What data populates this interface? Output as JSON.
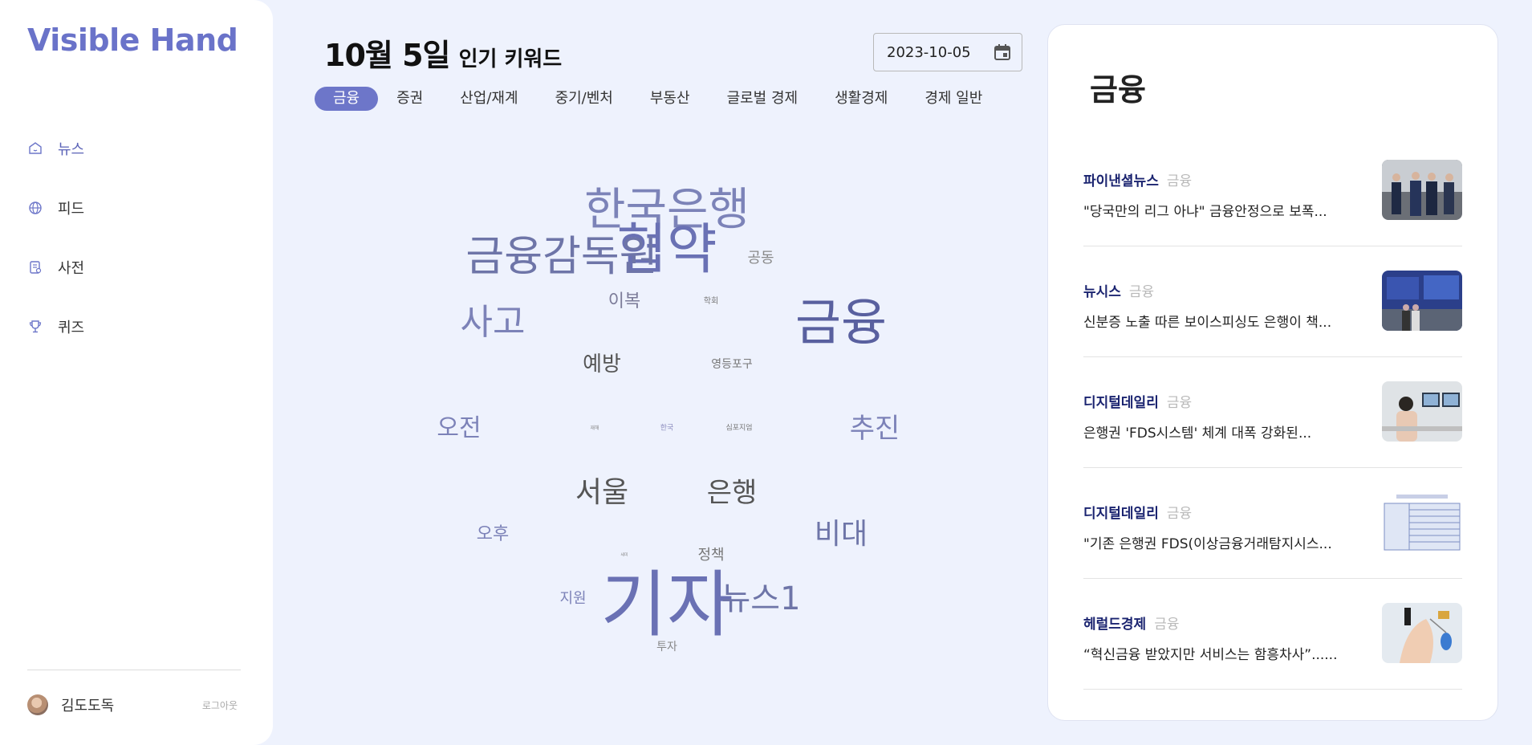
{
  "app": {
    "logo": "Visible Hand"
  },
  "sidebar": {
    "items": [
      {
        "label": "뉴스",
        "icon": "home-icon",
        "active": true
      },
      {
        "label": "피드",
        "icon": "globe-icon",
        "active": false
      },
      {
        "label": "사전",
        "icon": "dictionary-icon",
        "active": false
      },
      {
        "label": "퀴즈",
        "icon": "trophy-icon",
        "active": false
      }
    ],
    "user": {
      "name": "김도도독",
      "logout": "로그아웃"
    }
  },
  "header": {
    "date_big": "10월 5일",
    "subtitle": "인기 키워드",
    "date_value": "2023-10-05"
  },
  "tabs": [
    {
      "label": "금융",
      "active": true
    },
    {
      "label": "증권"
    },
    {
      "label": "산업/재계"
    },
    {
      "label": "중기/벤처"
    },
    {
      "label": "부동산"
    },
    {
      "label": "글로벌 경제"
    },
    {
      "label": "생활경제"
    },
    {
      "label": "경제 일반"
    }
  ],
  "wordcloud": [
    {
      "text": "한국은행",
      "weight": 56,
      "color": "#7c83b8"
    },
    {
      "text": "협약",
      "weight": 68,
      "color": "#6a71b4"
    },
    {
      "text": "금융감독원",
      "weight": 52,
      "color": "#6e75a8"
    },
    {
      "text": "공동",
      "weight": 18,
      "color": "#888"
    },
    {
      "text": "이복",
      "weight": 22,
      "color": "#7c7c99"
    },
    {
      "text": "학회",
      "weight": 10,
      "color": "#777"
    },
    {
      "text": "사고",
      "weight": 44,
      "color": "#7c82b8"
    },
    {
      "text": "금융",
      "weight": 62,
      "color": "#59609f"
    },
    {
      "text": "예방",
      "weight": 26,
      "color": "#555"
    },
    {
      "text": "영등포구",
      "weight": 14,
      "color": "#777"
    },
    {
      "text": "오전",
      "weight": 30,
      "color": "#7c82b8"
    },
    {
      "text": "재해",
      "weight": 6,
      "color": "#888"
    },
    {
      "text": "한국",
      "weight": 9,
      "color": "#8e8ec0"
    },
    {
      "text": "심포지엄",
      "weight": 9,
      "color": "#777"
    },
    {
      "text": "추진",
      "weight": 34,
      "color": "#7c82b8"
    },
    {
      "text": "서울",
      "weight": 36,
      "color": "#555"
    },
    {
      "text": "은행",
      "weight": 34,
      "color": "#555"
    },
    {
      "text": "오후",
      "weight": 22,
      "color": "#7c82b8"
    },
    {
      "text": "비대",
      "weight": 36,
      "color": "#6e75a8"
    },
    {
      "text": "정책",
      "weight": 18,
      "color": "#777"
    },
    {
      "text": "세미",
      "weight": 5,
      "color": "#888"
    },
    {
      "text": "지원",
      "weight": 18,
      "color": "#7c82b8"
    },
    {
      "text": "기자",
      "weight": 90,
      "color": "#6a71b4"
    },
    {
      "text": "뉴스1",
      "weight": 40,
      "color": "#6e75a8"
    },
    {
      "text": "투자",
      "weight": 14,
      "color": "#888"
    }
  ],
  "panel": {
    "title": "금융",
    "news": [
      {
        "source": "파이낸셜뉴스",
        "category": "금융",
        "headline": "\"당국만의 리그 아냐\" 금융안정으로 보폭...",
        "thumb": "people-photo"
      },
      {
        "source": "뉴시스",
        "category": "금융",
        "headline": "신분증 노출 따른 보이스피싱도 은행이 책...",
        "thumb": "conference-photo"
      },
      {
        "source": "디지털데일리",
        "category": "금융",
        "headline": "은행권 'FDS시스템' 체계 대폭 강화된...",
        "thumb": "office-photo"
      },
      {
        "source": "디지털데일리",
        "category": "금융",
        "headline": "\"기존 은행권 FDS(이상금융거래탐지시스...",
        "thumb": "document-photo"
      },
      {
        "source": "헤럴드경제",
        "category": "금융",
        "headline": "“혁신금융 받았지만 서비스는 함흥차사”......",
        "thumb": "product-photo"
      }
    ]
  },
  "colors": {
    "accent": "#6d76c9",
    "logo": "#6a73c9",
    "source": "#1b2470",
    "bg": "#eef2fd"
  }
}
